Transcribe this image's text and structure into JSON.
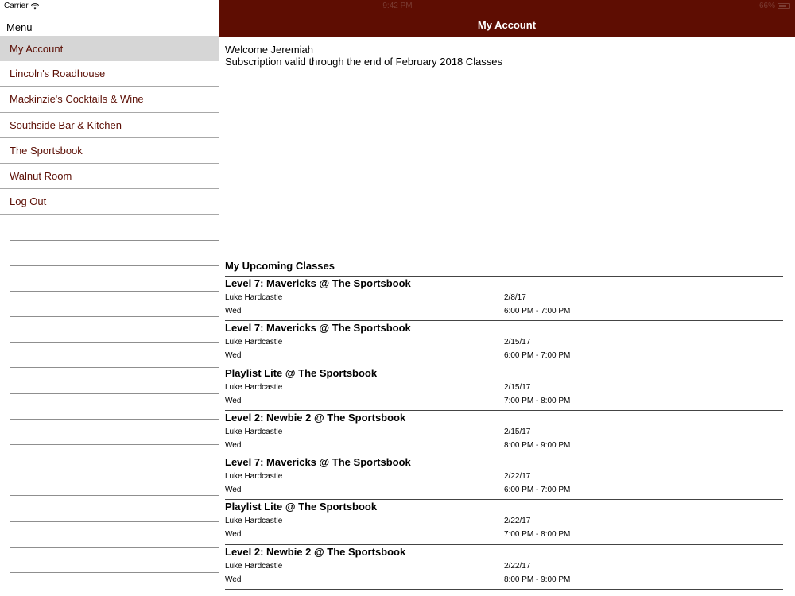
{
  "status": {
    "carrier": "Carrier",
    "time": "9:42 PM",
    "battery": "66%"
  },
  "sidebar": {
    "title": "Menu",
    "items": [
      {
        "label": "My Account",
        "active": true
      },
      {
        "label": "Lincoln's Roadhouse",
        "active": false
      },
      {
        "label": "Mackinzie's Cocktails & Wine",
        "active": false
      },
      {
        "label": "Southside Bar & Kitchen",
        "active": false
      },
      {
        "label": "The Sportsbook",
        "active": false
      },
      {
        "label": "Walnut Room",
        "active": false
      },
      {
        "label": "Log Out",
        "active": false
      }
    ]
  },
  "header": {
    "title": "My Account"
  },
  "account": {
    "welcome": "Welcome Jeremiah",
    "subscription": "Subscription valid through the end of February 2018 Classes"
  },
  "classes": {
    "title": "My Upcoming Classes",
    "rows": [
      {
        "title": "Level 7: Mavericks @ The Sportsbook",
        "instructor": "Luke Hardcastle",
        "day": "Wed",
        "date": "2/8/17",
        "time": "6:00 PM - 7:00 PM"
      },
      {
        "title": "Level 7: Mavericks @ The Sportsbook",
        "instructor": "Luke Hardcastle",
        "day": "Wed",
        "date": "2/15/17",
        "time": "6:00 PM - 7:00 PM"
      },
      {
        "title": "Playlist Lite @ The Sportsbook",
        "instructor": "Luke Hardcastle",
        "day": "Wed",
        "date": "2/15/17",
        "time": "7:00 PM - 8:00 PM"
      },
      {
        "title": "Level 2: Newbie 2 @ The Sportsbook",
        "instructor": "Luke Hardcastle",
        "day": "Wed",
        "date": "2/15/17",
        "time": "8:00 PM - 9:00 PM"
      },
      {
        "title": "Level 7: Mavericks @ The Sportsbook",
        "instructor": "Luke Hardcastle",
        "day": "Wed",
        "date": "2/22/17",
        "time": "6:00 PM - 7:00 PM"
      },
      {
        "title": "Playlist Lite @ The Sportsbook",
        "instructor": "Luke Hardcastle",
        "day": "Wed",
        "date": "2/22/17",
        "time": "7:00 PM - 8:00 PM"
      },
      {
        "title": "Level 2: Newbie 2 @ The Sportsbook",
        "instructor": "Luke Hardcastle",
        "day": "Wed",
        "date": "2/22/17",
        "time": "8:00 PM - 9:00 PM"
      }
    ]
  },
  "colors": {
    "brand": "#5e0d02",
    "menu_text": "#5c0f05",
    "active_bg": "#d6d6d6"
  },
  "icons": {
    "wifi": "wifi-icon",
    "battery": "battery-icon"
  }
}
